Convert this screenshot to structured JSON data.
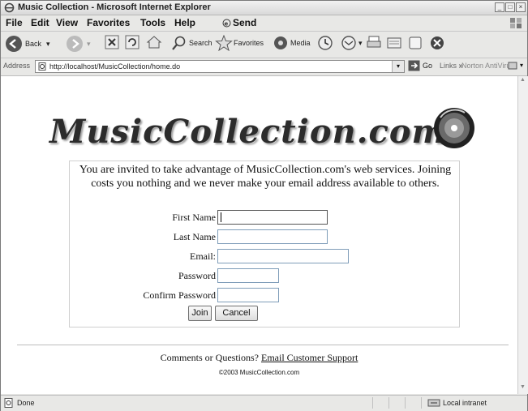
{
  "window": {
    "title": "Music Collection - Microsoft Internet Explorer"
  },
  "menu": [
    "File",
    "Edit",
    "View",
    "Favorites",
    "Tools",
    "Help",
    "Send"
  ],
  "toolbar": {
    "back": "Back",
    "search": "Search",
    "favorites": "Favorites",
    "media": "Media"
  },
  "address": {
    "label": "Address",
    "url": "http://localhost/MusicCollection/home.do",
    "go": "Go",
    "links": "Links",
    "links_chevron": "»",
    "norton": "Norton AntiVirus"
  },
  "page": {
    "logo": "MusicCollection.com",
    "intro": "You are invited to take advantage of MusicCollection.com's web services. Joining costs you nothing and we never make your email address available to others.",
    "fields": {
      "first_name": "First Name",
      "last_name": "Last Name",
      "email": "Email:",
      "password": "Password",
      "confirm_password": "Confirm Password"
    },
    "buttons": {
      "join": "Join",
      "cancel": "Cancel"
    },
    "footer": {
      "prefix": "Comments or Questions?",
      "link": "Email Customer Support"
    },
    "copyright": "©2003 MusicCollection.com"
  },
  "status": {
    "left": "Done",
    "zone": "Local intranet"
  }
}
